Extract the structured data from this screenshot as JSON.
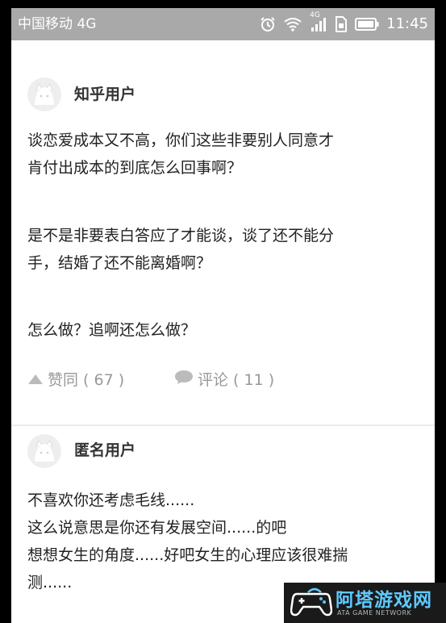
{
  "status_bar": {
    "carrier": "中国移动 4G",
    "network_badge": "4G",
    "time": "11:45"
  },
  "comments": [
    {
      "username": "知乎用户",
      "paragraphs": [
        "谈恋爱成本又不高，你们这些非要别人同意才",
        "肯付出成本的到底怎么回事啊？",
        "是不是非要表白答应了才能谈，谈了还不能分",
        "手，结婚了还不能离婚啊？",
        "怎么做？追啊还怎么做？"
      ],
      "like_label": "赞同 ( 67 )",
      "comment_label": "评论 ( 11 )"
    },
    {
      "username": "匿名用户",
      "lines": [
        "不喜欢你还考虑毛线......",
        "这么说意思是你还有发展空间......的吧",
        "想想女生的角度......好吧女生的心理应该很难揣",
        "测......"
      ]
    }
  ],
  "watermark": {
    "title": "阿塔游戏网",
    "subtitle": "ATA GAME NETWORK"
  },
  "colors": {
    "status_bar_bg": "#a9a9a9",
    "action_gray": "#999999",
    "text": "#222222",
    "watermark_blue": "#5fc9ff"
  }
}
